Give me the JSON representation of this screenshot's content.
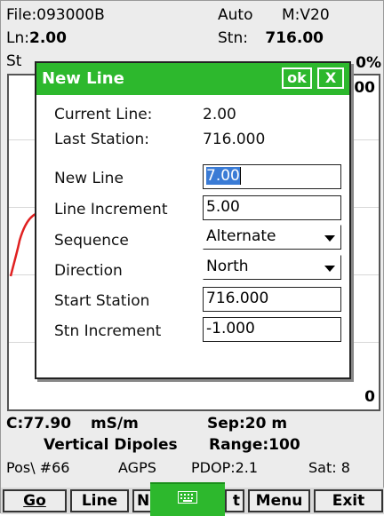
{
  "header": {
    "file": "File:093000B",
    "mode": "Auto",
    "meter": "M:V20",
    "line_label": "Ln:",
    "line_value": "2.00",
    "station_label": "Stn:",
    "station_value": "716.00",
    "partial_label": "St"
  },
  "graph": {
    "top_right": "0%",
    "top_value": "00",
    "bottom_value": "0"
  },
  "dialog": {
    "title": "New Line",
    "ok_label": "ok",
    "close_label": "X",
    "current_line_label": "Current Line:",
    "current_line_value": "2.00",
    "last_station_label": "Last Station:",
    "last_station_value": "716.000",
    "new_line_label": "New Line",
    "new_line_value": "7.00",
    "line_increment_label": "Line Increment",
    "line_increment_value": "5.00",
    "sequence_label": "Sequence",
    "sequence_value": "Alternate",
    "direction_label": "Direction",
    "direction_value": "North",
    "start_station_label": "Start Station",
    "start_station_value": "716.000",
    "stn_increment_label": "Stn Increment",
    "stn_increment_value": "-1.000"
  },
  "footer": {
    "conductivity": "C:77.90",
    "units": "mS/m",
    "separation": "Sep:20 m",
    "dipoles": "Vertical Dipoles",
    "range": "Range:100",
    "pos": "Pos\\ #66",
    "gps": "AGPS",
    "pdop": "PDOP:2.1",
    "sat": "Sat: 8"
  },
  "buttons": {
    "go": "Go",
    "line": "Line",
    "n_partial": "N",
    "t_partial": "t",
    "menu": "Menu",
    "exit": "Exit"
  },
  "colors": {
    "accent_green": "#2db82d",
    "trace_red": "#e02020"
  },
  "icons": {
    "keyboard": "keyboard-icon",
    "dropdown": "chevron-down-icon"
  }
}
